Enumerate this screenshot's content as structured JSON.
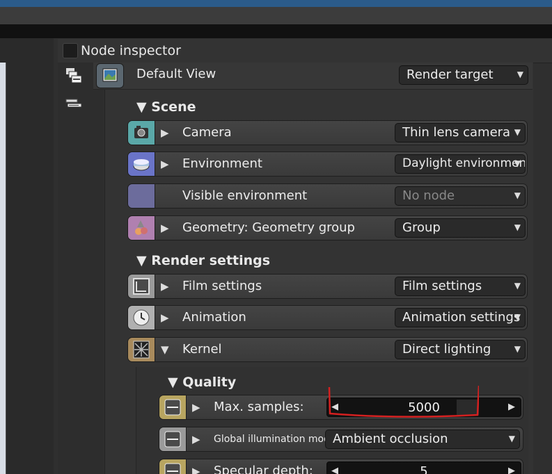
{
  "header": {
    "title": "Node inspector"
  },
  "default_view": {
    "label": "Default View",
    "dropdown": "Render target"
  },
  "scene": {
    "title": "Scene",
    "rows": [
      {
        "icon": "camera-icon",
        "label": "Camera",
        "value": "Thin lens camera",
        "color": "#5aa8a8"
      },
      {
        "icon": "environment-icon",
        "label": "Environment",
        "value": "Daylight environment",
        "color": "#6a74c8"
      },
      {
        "icon": "visible-environment-icon",
        "label": "Visible environment",
        "value": "No node",
        "color": "#6c6c9c"
      },
      {
        "icon": "geometry-icon",
        "label": "Geometry: Geometry group",
        "value": "Group",
        "color": "#b080b0"
      }
    ]
  },
  "render_settings": {
    "title": "Render settings",
    "rows": [
      {
        "icon": "film-icon",
        "label": "Film settings",
        "value": "Film settings",
        "color": "#9a9a9a"
      },
      {
        "icon": "clock-icon",
        "label": "Animation",
        "value": "Animation settings",
        "color": "#b0b0b0"
      },
      {
        "icon": "kernel-icon",
        "label": "Kernel",
        "value": "Direct lighting",
        "color": "#a88a5c"
      }
    ]
  },
  "quality": {
    "title": "Quality",
    "max_samples": {
      "label": "Max. samples:",
      "value": "5000"
    },
    "gi_mode": {
      "label": "Global illumination mode:",
      "value": "Ambient occlusion"
    },
    "specular_depth": {
      "label": "Specular depth:",
      "value": "5"
    }
  },
  "colors": {
    "accent": "#2b5b8a",
    "annotation": "#d42020"
  }
}
